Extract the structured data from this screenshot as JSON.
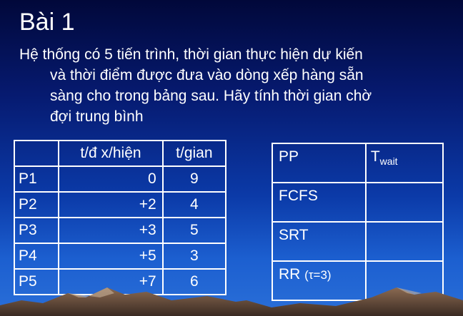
{
  "slide": {
    "title": "Bài 1",
    "body_lines": [
      "Hệ thống có 5 tiến trình, thời gian thực hiện dự kiến",
      "và thời điểm được đưa vào dòng xếp hàng sẵn",
      "sàng cho trong bảng sau. Hãy tính thời gian chờ",
      "đợi trung bình"
    ]
  },
  "process_table": {
    "headers": [
      "",
      "t/đ x/hiện",
      "t/gian"
    ],
    "rows": [
      {
        "name": "P1",
        "arrival": "0",
        "burst": "9"
      },
      {
        "name": "P2",
        "arrival": "+2",
        "burst": "4"
      },
      {
        "name": "P3",
        "arrival": "+3",
        "burst": "5"
      },
      {
        "name": "P4",
        "arrival": "+5",
        "burst": "3"
      },
      {
        "name": "P5",
        "arrival": "+7",
        "burst": "6"
      }
    ]
  },
  "result_table": {
    "header_pp": "PP",
    "header_twait_main": "T",
    "header_twait_sub": "wait",
    "rows": [
      {
        "method": "FCFS",
        "tau": "",
        "value": ""
      },
      {
        "method": "SRT",
        "tau": "",
        "value": ""
      },
      {
        "method": "RR ",
        "tau": "(τ=3)",
        "value": ""
      }
    ]
  },
  "colors": {
    "background_top": "#01083a",
    "background_bottom": "#2a6fd8",
    "text": "#ffffff"
  }
}
